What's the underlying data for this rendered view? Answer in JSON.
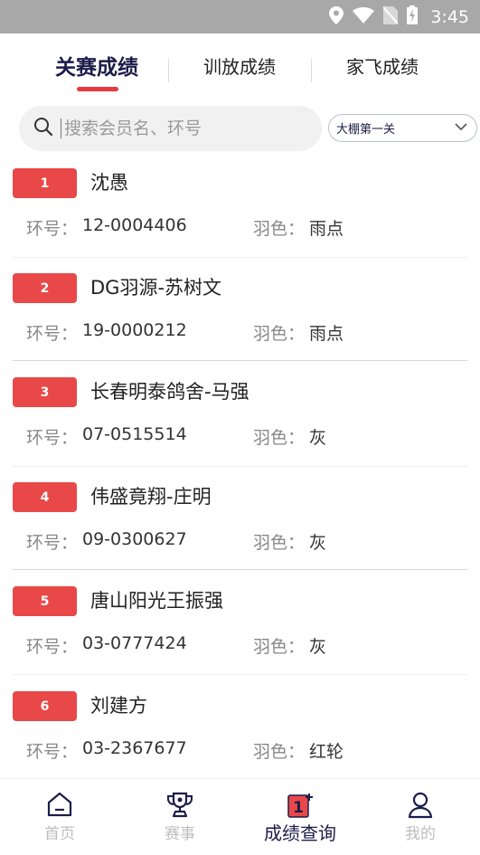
{
  "status_bar": {
    "time": "3:45"
  },
  "tabs": [
    {
      "label": "关赛成绩",
      "active": true
    },
    {
      "label": "训放成绩",
      "active": false
    },
    {
      "label": "家飞成绩",
      "active": false
    }
  ],
  "search": {
    "placeholder": "搜索会员名、环号",
    "value": ""
  },
  "filter": {
    "selected": "大棚第一关"
  },
  "field_labels": {
    "ring": "环号：",
    "color": "羽色："
  },
  "results": [
    {
      "rank": "1",
      "name": "沈愚",
      "ring": "12-0004406",
      "color": "雨点"
    },
    {
      "rank": "2",
      "name": "DG羽源-苏树文",
      "ring": "19-0000212",
      "color": "雨点"
    },
    {
      "rank": "3",
      "name": "长春明泰鸽舍-马强",
      "ring": "07-0515514",
      "color": "灰"
    },
    {
      "rank": "4",
      "name": "伟盛竟翔-庄明",
      "ring": "09-0300627",
      "color": "灰"
    },
    {
      "rank": "5",
      "name": "唐山阳光王振强",
      "ring": "03-0777424",
      "color": "灰"
    },
    {
      "rank": "6",
      "name": "刘建方",
      "ring": "03-2367677",
      "color": "红轮"
    }
  ],
  "bottom_nav": [
    {
      "label": "首页",
      "icon": "home-icon",
      "active": false
    },
    {
      "label": "赛事",
      "icon": "trophy-icon",
      "active": false
    },
    {
      "label": "成绩查询",
      "icon": "results-icon",
      "active": true
    },
    {
      "label": "我的",
      "icon": "profile-icon",
      "active": false
    }
  ],
  "colors": {
    "accent": "#e84848",
    "brand_navy": "#1c1c4a",
    "inactive": "#bdbdbd"
  }
}
